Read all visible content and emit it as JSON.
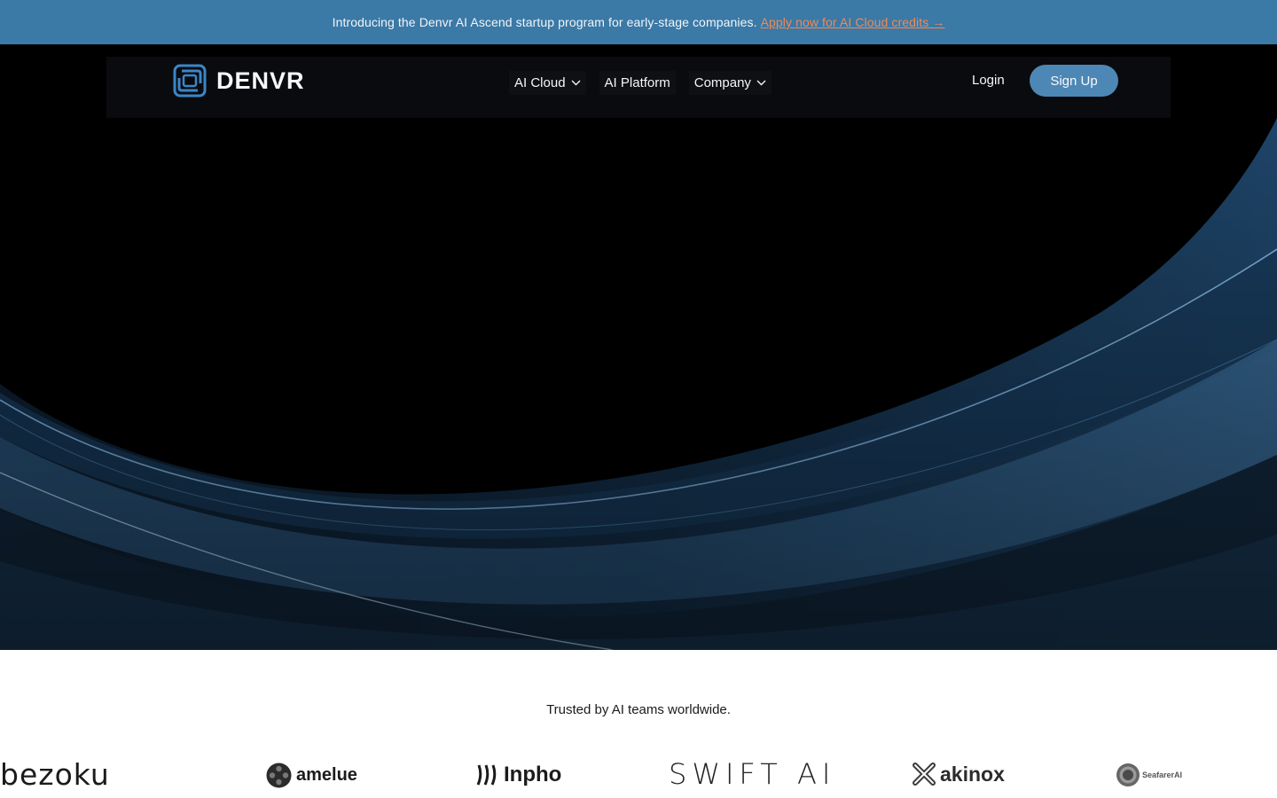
{
  "announcement": {
    "text": "Introducing the Denvr AI Ascend startup program for early-stage companies.",
    "cta": "Apply now for AI Cloud credits →"
  },
  "nav": {
    "brand": "DENVR",
    "items": [
      {
        "label": "AI Cloud",
        "has_dropdown": true
      },
      {
        "label": "AI Platform",
        "has_dropdown": false
      },
      {
        "label": "Company",
        "has_dropdown": true
      }
    ],
    "login": "Login",
    "signup": "Sign Up"
  },
  "trusted": {
    "caption": "Trusted by AI teams worldwide.",
    "logos": [
      "bezoku",
      "amelue",
      "Inpho",
      "SWIFT AI",
      "akinox",
      "SeafarerAI"
    ]
  },
  "colors": {
    "announcement_bg": "#3b79a6",
    "cta": "#f08a57",
    "signup_bg": "#4d87b6",
    "hero_bg": "#000000"
  }
}
